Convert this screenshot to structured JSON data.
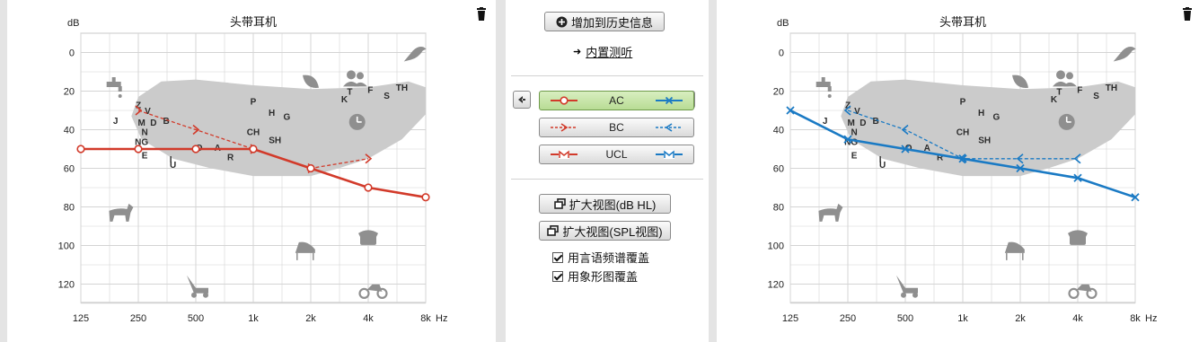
{
  "left_chart": {
    "title": "头带耳机",
    "y_unit": "dB",
    "x_unit": "Hz",
    "y_ticks": [
      "0",
      "20",
      "40",
      "60",
      "80",
      "100",
      "120"
    ],
    "x_ticks": [
      "125",
      "250",
      "500",
      "1k",
      "2k",
      "4k",
      "8k"
    ]
  },
  "right_chart": {
    "title": "头带耳机",
    "y_unit": "dB",
    "x_unit": "Hz",
    "y_ticks": [
      "0",
      "20",
      "40",
      "60",
      "80",
      "100",
      "120"
    ],
    "x_ticks": [
      "125",
      "250",
      "500",
      "1k",
      "2k",
      "4k",
      "8k"
    ]
  },
  "speech_letters": [
    {
      "t": "Z",
      "f": 250,
      "db": 27
    },
    {
      "t": "V",
      "f": 280,
      "db": 30
    },
    {
      "t": "J",
      "f": 190,
      "db": 35
    },
    {
      "t": "M",
      "f": 260,
      "db": 36
    },
    {
      "t": "D",
      "f": 300,
      "db": 36
    },
    {
      "t": "B",
      "f": 350,
      "db": 35
    },
    {
      "t": "N",
      "f": 270,
      "db": 41
    },
    {
      "t": "NG",
      "f": 260,
      "db": 46
    },
    {
      "t": "E",
      "f": 270,
      "db": 53
    },
    {
      "t": "I",
      "f": 370,
      "db": 55
    },
    {
      "t": "U",
      "f": 380,
      "db": 58
    },
    {
      "t": "O",
      "f": 520,
      "db": 49
    },
    {
      "t": "A",
      "f": 650,
      "db": 49
    },
    {
      "t": "R",
      "f": 760,
      "db": 54
    },
    {
      "t": "P",
      "f": 1000,
      "db": 25
    },
    {
      "t": "H",
      "f": 1250,
      "db": 31
    },
    {
      "t": "G",
      "f": 1500,
      "db": 33
    },
    {
      "t": "CH",
      "f": 1000,
      "db": 41
    },
    {
      "t": "SH",
      "f": 1300,
      "db": 45
    },
    {
      "t": "K",
      "f": 3000,
      "db": 24
    },
    {
      "t": "T",
      "f": 3200,
      "db": 20
    },
    {
      "t": "F",
      "f": 4100,
      "db": 19
    },
    {
      "t": "S",
      "f": 5000,
      "db": 22
    },
    {
      "t": "TH",
      "f": 6000,
      "db": 18
    }
  ],
  "left_series": {
    "ac": {
      "name": "AC",
      "color": "#d23a2a",
      "points": [
        [
          125,
          50
        ],
        [
          250,
          50
        ],
        [
          500,
          50
        ],
        [
          1000,
          50
        ],
        [
          2000,
          60
        ],
        [
          4000,
          70
        ],
        [
          8000,
          75
        ]
      ]
    },
    "bc": {
      "name": "BC",
      "color": "#d23a2a",
      "points": [
        [
          250,
          30
        ],
        [
          500,
          40
        ],
        [
          1000,
          50
        ],
        [
          2000,
          60
        ],
        [
          4000,
          55
        ]
      ]
    }
  },
  "right_series": {
    "ac": {
      "name": "AC",
      "color": "#1a7ac4",
      "points": [
        [
          125,
          30
        ],
        [
          250,
          45
        ],
        [
          500,
          50
        ],
        [
          1000,
          55
        ],
        [
          2000,
          60
        ],
        [
          4000,
          65
        ],
        [
          8000,
          75
        ]
      ]
    },
    "bc": {
      "name": "BC",
      "color": "#1a7ac4",
      "points": [
        [
          250,
          30
        ],
        [
          500,
          40
        ],
        [
          1000,
          55
        ],
        [
          2000,
          55
        ],
        [
          4000,
          55
        ]
      ]
    }
  },
  "sidebar": {
    "add_history_label": "增加到历史信息",
    "builtin_test_label": "内置测听",
    "legend": [
      {
        "label": "AC",
        "left_color": "#d23a2a",
        "right_color": "#1a7ac4",
        "active": true
      },
      {
        "label": "BC",
        "left_color": "#d23a2a",
        "right_color": "#1a7ac4",
        "active": false
      },
      {
        "label": "UCL",
        "left_color": "#d23a2a",
        "right_color": "#1a7ac4",
        "active": false
      }
    ],
    "expand_hl_label": "扩大视图(dB HL)",
    "expand_spl_label": "扩大视图(SPL视图)",
    "speech_banana_label": "用言语频谱覆盖",
    "icon_overlay_label": "用象形图覆盖",
    "speech_banana_checked": true,
    "icon_overlay_checked": true
  },
  "icons": [
    "faucet-icon",
    "bird-icon",
    "people-icon",
    "leaf-icon",
    "clock-icon",
    "dog-icon",
    "piano-icon",
    "telephone-icon",
    "lawnmower-icon",
    "motorcycle-icon",
    "trash-icon"
  ]
}
